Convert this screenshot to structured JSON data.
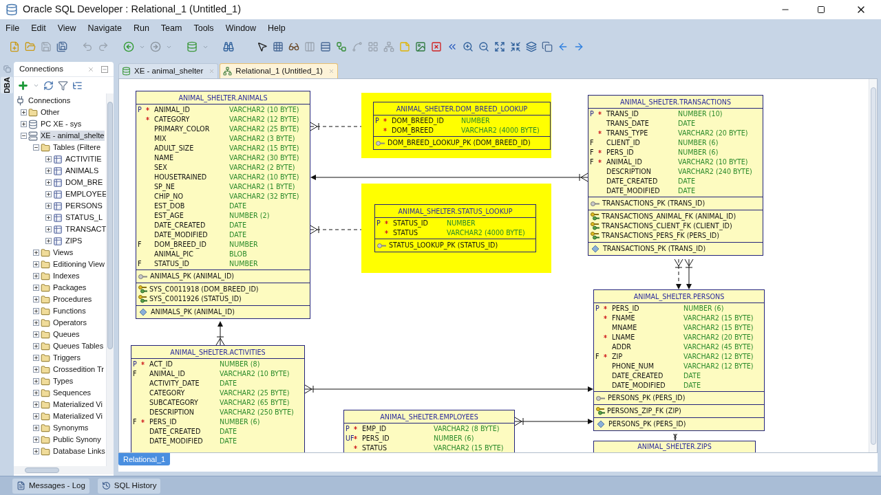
{
  "window": {
    "title": "Oracle SQL Developer : Relational_1 (Untitled_1)"
  },
  "menu": [
    "File",
    "Edit",
    "View",
    "Navigate",
    "Run",
    "Team",
    "Tools",
    "Window",
    "Help"
  ],
  "side_strip": {
    "label": "DBA"
  },
  "connections_panel": {
    "title": "Connections",
    "tree": [
      {
        "label": "Connections",
        "kind": "connections",
        "selected": false,
        "children": [
          {
            "label": "Other",
            "kind": "folder",
            "expanded": false,
            "selected": false
          },
          {
            "label": "PC XE - sys",
            "kind": "database",
            "expanded": false,
            "selected": false
          },
          {
            "label": "XE - animal_shelte",
            "kind": "connection",
            "expanded": true,
            "selected": true,
            "children": [
              {
                "label": "Tables (Filtere",
                "kind": "folder",
                "expanded": true,
                "selected": false,
                "children": [
                  {
                    "label": "ACTIVITIE",
                    "kind": "table",
                    "expanded": false,
                    "selected": false
                  },
                  {
                    "label": "ANIMALS",
                    "kind": "table",
                    "expanded": false,
                    "selected": false
                  },
                  {
                    "label": "DOM_BRE",
                    "kind": "table",
                    "expanded": false,
                    "selected": false
                  },
                  {
                    "label": "EMPLOYEE",
                    "kind": "table",
                    "expanded": false,
                    "selected": false
                  },
                  {
                    "label": "PERSONS",
                    "kind": "table",
                    "expanded": false,
                    "selected": false
                  },
                  {
                    "label": "STATUS_L",
                    "kind": "table",
                    "expanded": false,
                    "selected": false
                  },
                  {
                    "label": "TRANSACT",
                    "kind": "table",
                    "expanded": false,
                    "selected": false
                  },
                  {
                    "label": "ZIPS",
                    "kind": "table",
                    "expanded": false,
                    "selected": false
                  }
                ]
              },
              {
                "label": "Views",
                "kind": "folder",
                "expanded": false,
                "selected": false
              },
              {
                "label": "Editioning View",
                "kind": "folder",
                "expanded": false,
                "selected": false
              },
              {
                "label": "Indexes",
                "kind": "folder",
                "expanded": false,
                "selected": false
              },
              {
                "label": "Packages",
                "kind": "folder",
                "expanded": false,
                "selected": false
              },
              {
                "label": "Procedures",
                "kind": "folder",
                "expanded": false,
                "selected": false
              },
              {
                "label": "Functions",
                "kind": "folder",
                "expanded": false,
                "selected": false
              },
              {
                "label": "Operators",
                "kind": "folder",
                "expanded": false,
                "selected": false
              },
              {
                "label": "Queues",
                "kind": "folder",
                "expanded": false,
                "selected": false
              },
              {
                "label": "Queues Tables",
                "kind": "folder",
                "expanded": false,
                "selected": false
              },
              {
                "label": "Triggers",
                "kind": "folder",
                "expanded": false,
                "selected": false
              },
              {
                "label": "Crossedition Tr",
                "kind": "folder",
                "expanded": false,
                "selected": false
              },
              {
                "label": "Types",
                "kind": "folder",
                "expanded": false,
                "selected": false
              },
              {
                "label": "Sequences",
                "kind": "folder",
                "expanded": false,
                "selected": false
              },
              {
                "label": "Materialized Vi",
                "kind": "folder",
                "expanded": false,
                "selected": false
              },
              {
                "label": "Materialized Vi",
                "kind": "folder",
                "expanded": false,
                "selected": false
              },
              {
                "label": "Synonyms",
                "kind": "folder",
                "expanded": false,
                "selected": false
              },
              {
                "label": "Public Synony",
                "kind": "folder",
                "expanded": false,
                "selected": false
              },
              {
                "label": "Database Links",
                "kind": "folder",
                "expanded": false,
                "selected": false
              }
            ]
          }
        ]
      }
    ]
  },
  "editor_tabs": [
    {
      "label": "XE - animal_shelter",
      "kind": "worksheet",
      "selected": false
    },
    {
      "label": "Relational_1 (Untitled_1)",
      "kind": "diagram",
      "selected": true
    }
  ],
  "diagram": {
    "tables": [
      {
        "name": "ANIMAL_SHELTER.ANIMALS",
        "highlighted": false,
        "columns": [
          {
            "flag": "P",
            "required": true,
            "name": "ANIMAL_ID",
            "type": "VARCHAR2 (10 BYTE)"
          },
          {
            "required": true,
            "name": "CATEGORY",
            "type": "VARCHAR2 (12 BYTE)"
          },
          {
            "required": false,
            "name": "PRIMARY_COLOR",
            "type": "VARCHAR2 (25 BYTE)"
          },
          {
            "required": false,
            "name": "MIX",
            "type": "VARCHAR2 (3 BYTE)"
          },
          {
            "required": false,
            "name": "ADULT_SIZE",
            "type": "VARCHAR2 (15 BYTE)"
          },
          {
            "required": false,
            "name": "NAME",
            "type": "VARCHAR2 (30 BYTE)"
          },
          {
            "required": false,
            "name": "SEX",
            "type": "VARCHAR2 (2 BYTE)"
          },
          {
            "required": false,
            "name": "HOUSETRAINED",
            "type": "VARCHAR2 (10 BYTE)"
          },
          {
            "required": false,
            "name": "SP_NE",
            "type": "VARCHAR2 (1 BYTE)"
          },
          {
            "required": false,
            "name": "CHIP_NO",
            "type": "VARCHAR2 (32 BYTE)"
          },
          {
            "required": false,
            "name": "EST_DOB",
            "type": "DATE"
          },
          {
            "required": false,
            "name": "EST_AGE",
            "type": "NUMBER (2)"
          },
          {
            "required": false,
            "name": "DATE_CREATED",
            "type": "DATE"
          },
          {
            "required": false,
            "name": "DATE_MODIFIED",
            "type": "DATE"
          },
          {
            "flag": "F",
            "required": false,
            "name": "DOM_BREED_ID",
            "type": "NUMBER"
          },
          {
            "required": false,
            "name": "ANIMAL_PIC",
            "type": "BLOB"
          },
          {
            "flag": "F",
            "required": false,
            "name": "STATUS_ID",
            "type": "NUMBER"
          }
        ],
        "key_sections": [
          [
            {
              "kind": "pk",
              "text": "ANIMALS_PK (ANIMAL_ID)"
            }
          ],
          [
            {
              "kind": "fk",
              "text": "SYS_C0011918 (DOM_BREED_ID)"
            },
            {
              "kind": "fk",
              "text": "SYS_C0011926 (STATUS_ID)"
            }
          ],
          [
            {
              "kind": "index",
              "text": "ANIMALS_PK (ANIMAL_ID)"
            }
          ]
        ]
      },
      {
        "name": "ANIMAL_SHELTER.DOM_BREED_LOOKUP",
        "highlighted": true,
        "columns": [
          {
            "flag": "P",
            "required": true,
            "name": "DOM_BREED_ID",
            "type": "NUMBER"
          },
          {
            "required": true,
            "name": "DOM_BREED",
            "type": "VARCHAR2 (4000 BYTE)"
          }
        ],
        "key_sections": [
          [
            {
              "kind": "pk",
              "text": "DOM_BREED_LOOKUP_PK (DOM_BREED_ID)"
            }
          ]
        ]
      },
      {
        "name": "ANIMAL_SHELTER.STATUS_LOOKUP",
        "highlighted": true,
        "columns": [
          {
            "flag": "P",
            "required": true,
            "name": "STATUS_ID",
            "type": "NUMBER"
          },
          {
            "required": true,
            "name": "STATUS",
            "type": "VARCHAR2 (4000 BYTE)"
          }
        ],
        "key_sections": [
          [
            {
              "kind": "pk",
              "text": "STATUS_LOOKUP_PK (STATUS_ID)"
            }
          ]
        ]
      },
      {
        "name": "ANIMAL_SHELTER.TRANSACTIONS",
        "highlighted": false,
        "columns": [
          {
            "flag": "P",
            "required": true,
            "name": "TRANS_ID",
            "type": "NUMBER (10)"
          },
          {
            "required": false,
            "name": "TRANS_DATE",
            "type": "DATE"
          },
          {
            "required": true,
            "name": "TRANS_TYPE",
            "type": "VARCHAR2 (20 BYTE)"
          },
          {
            "flag": "F",
            "required": false,
            "name": "CLIENT_ID",
            "type": "NUMBER (6)"
          },
          {
            "flag": "F",
            "required": true,
            "name": "PERS_ID",
            "type": "NUMBER (6)"
          },
          {
            "flag": "F",
            "required": true,
            "name": "ANIMAL_ID",
            "type": "VARCHAR2 (10 BYTE)"
          },
          {
            "required": false,
            "name": "DESCRIPTION",
            "type": "VARCHAR2 (240 BYTE)"
          },
          {
            "required": false,
            "name": "DATE_CREATED",
            "type": "DATE"
          },
          {
            "required": false,
            "name": "DATE_MODIFIED",
            "type": "DATE"
          }
        ],
        "key_sections": [
          [
            {
              "kind": "pk",
              "text": "TRANSACTIONS_PK (TRANS_ID)"
            }
          ],
          [
            {
              "kind": "fk",
              "text": "TRANSACTIONS_ANIMAL_FK (ANIMAL_ID)"
            },
            {
              "kind": "fk",
              "text": "TRANSACTIONS_CLIENT_FK (CLIENT_ID)"
            },
            {
              "kind": "fk",
              "text": "TRANSACTIONS_PERS_FK (PERS_ID)"
            }
          ],
          [
            {
              "kind": "index",
              "text": "TRANSACTIONS_PK (TRANS_ID)"
            }
          ]
        ]
      },
      {
        "name": "ANIMAL_SHELTER.PERSONS",
        "highlighted": false,
        "columns": [
          {
            "flag": "P",
            "required": true,
            "name": "PERS_ID",
            "type": "NUMBER (6)"
          },
          {
            "required": true,
            "name": "FNAME",
            "type": "VARCHAR2 (15 BYTE)"
          },
          {
            "required": false,
            "name": "MNAME",
            "type": "VARCHAR2 (15 BYTE)"
          },
          {
            "required": true,
            "name": "LNAME",
            "type": "VARCHAR2 (20 BYTE)"
          },
          {
            "required": false,
            "name": "ADDR",
            "type": "VARCHAR2 (45 BYTE)"
          },
          {
            "flag": "F",
            "required": true,
            "name": "ZIP",
            "type": "VARCHAR2 (12 BYTE)"
          },
          {
            "required": false,
            "name": "PHONE_NUM",
            "type": "VARCHAR2 (12 BYTE)"
          },
          {
            "required": false,
            "name": "DATE_CREATED",
            "type": "DATE"
          },
          {
            "required": false,
            "name": "DATE_MODIFIED",
            "type": "DATE"
          }
        ],
        "key_sections": [
          [
            {
              "kind": "pk",
              "text": "PERSONS_PK (PERS_ID)"
            }
          ],
          [
            {
              "kind": "fk",
              "text": "PERSONS_ZIP_FK (ZIP)"
            }
          ],
          [
            {
              "kind": "index",
              "text": "PERSONS_PK (PERS_ID)"
            }
          ]
        ]
      },
      {
        "name": "ANIMAL_SHELTER.ZIPS",
        "highlighted": false
      },
      {
        "name": "ANIMAL_SHELTER.ACTIVITIES",
        "highlighted": false,
        "columns": [
          {
            "flag": "P",
            "required": true,
            "name": "ACT_ID",
            "type": "NUMBER (8)"
          },
          {
            "flag": "F",
            "required": false,
            "name": "ANIMAL_ID",
            "type": "VARCHAR2 (10 BYTE)"
          },
          {
            "required": false,
            "name": "ACTIVITY_DATE",
            "type": "DATE"
          },
          {
            "required": false,
            "name": "CATEGORY",
            "type": "VARCHAR2 (25 BYTE)"
          },
          {
            "required": false,
            "name": "SUBCATEGORY",
            "type": "VARCHAR2 (65 BYTE)"
          },
          {
            "required": false,
            "name": "DESCRIPTION",
            "type": "VARCHAR2 (250 BYTE)"
          },
          {
            "flag": "F",
            "required": true,
            "name": "PERS_ID",
            "type": "NUMBER (6)"
          },
          {
            "required": false,
            "name": "DATE_CREATED",
            "type": "DATE"
          },
          {
            "required": false,
            "name": "DATE_MODIFIED",
            "type": "DATE"
          }
        ]
      },
      {
        "name": "ANIMAL_SHELTER.EMPLOYEES",
        "highlighted": false,
        "columns": [
          {
            "flag": "P",
            "required": true,
            "name": "EMP_ID",
            "type": "VARCHAR2 (8 BYTE)"
          },
          {
            "flag": "UF",
            "required": true,
            "name": "PERS_ID",
            "type": "NUMBER (6)"
          },
          {
            "required": true,
            "name": "STATUS",
            "type": "VARCHAR2 (15 BYTE)"
          }
        ]
      }
    ]
  },
  "diagram_tabs": [
    {
      "label": "Relational_1",
      "selected": true
    }
  ],
  "bottom_tabs": [
    {
      "label": "Messages - Log",
      "kind": "log"
    },
    {
      "label": "SQL History",
      "kind": "history"
    }
  ]
}
